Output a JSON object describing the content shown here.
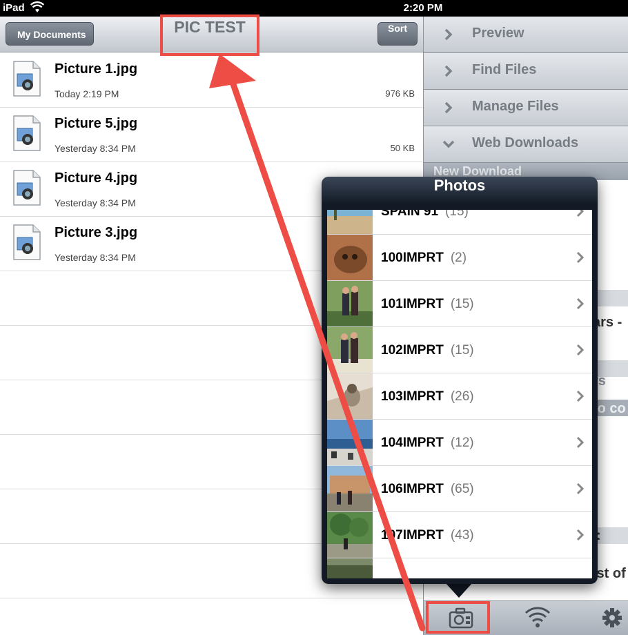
{
  "status_bar": {
    "carrier": "iPad",
    "time": "2:20 PM"
  },
  "navbar": {
    "back_label": "My Documents",
    "title": "PIC TEST",
    "sort_label": "Sort"
  },
  "files": [
    {
      "name": "Picture 1.jpg",
      "date": "Today 2:19 PM",
      "size": "976 KB"
    },
    {
      "name": "Picture 5.jpg",
      "date": "Yesterday 8:34 PM",
      "size": "50 KB"
    },
    {
      "name": "Picture 4.jpg",
      "date": "Yesterday 8:34 PM",
      "size": ""
    },
    {
      "name": "Picture 3.jpg",
      "date": "Yesterday 8:34 PM",
      "size": ""
    }
  ],
  "sidebar": {
    "items": [
      {
        "label": "Preview",
        "icon": "chevron-right-icon"
      },
      {
        "label": "Find Files",
        "icon": "chevron-right-icon"
      },
      {
        "label": "Manage Files",
        "icon": "chevron-right-icon"
      },
      {
        "label": "Web Downloads",
        "icon": "chevron-down-icon"
      }
    ],
    "section_header": "New Download",
    "fragments": {
      "a": "ars -",
      "b": "rs",
      "c": "to co",
      "d": ":",
      "e": "ist of"
    }
  },
  "tabbar": {
    "icons": [
      "camera-icon",
      "wifi-icon",
      "gear-icon"
    ]
  },
  "popover": {
    "title": "Photos",
    "albums": [
      {
        "name": "SPAIN 91",
        "count": "(15)"
      },
      {
        "name": "100IMPRT",
        "count": "(2)"
      },
      {
        "name": "101IMPRT",
        "count": "(15)"
      },
      {
        "name": "102IMPRT",
        "count": "(15)"
      },
      {
        "name": "103IMPRT",
        "count": "(26)"
      },
      {
        "name": "104IMPRT",
        "count": "(12)"
      },
      {
        "name": "106IMPRT",
        "count": "(65)"
      },
      {
        "name": "107IMPRT",
        "count": "(43)"
      },
      {
        "name": "",
        "count": ""
      }
    ]
  },
  "colors": {
    "annotation": "#ee4d45",
    "popover_bg": "#131a26",
    "nav_title": "#6d737b"
  }
}
